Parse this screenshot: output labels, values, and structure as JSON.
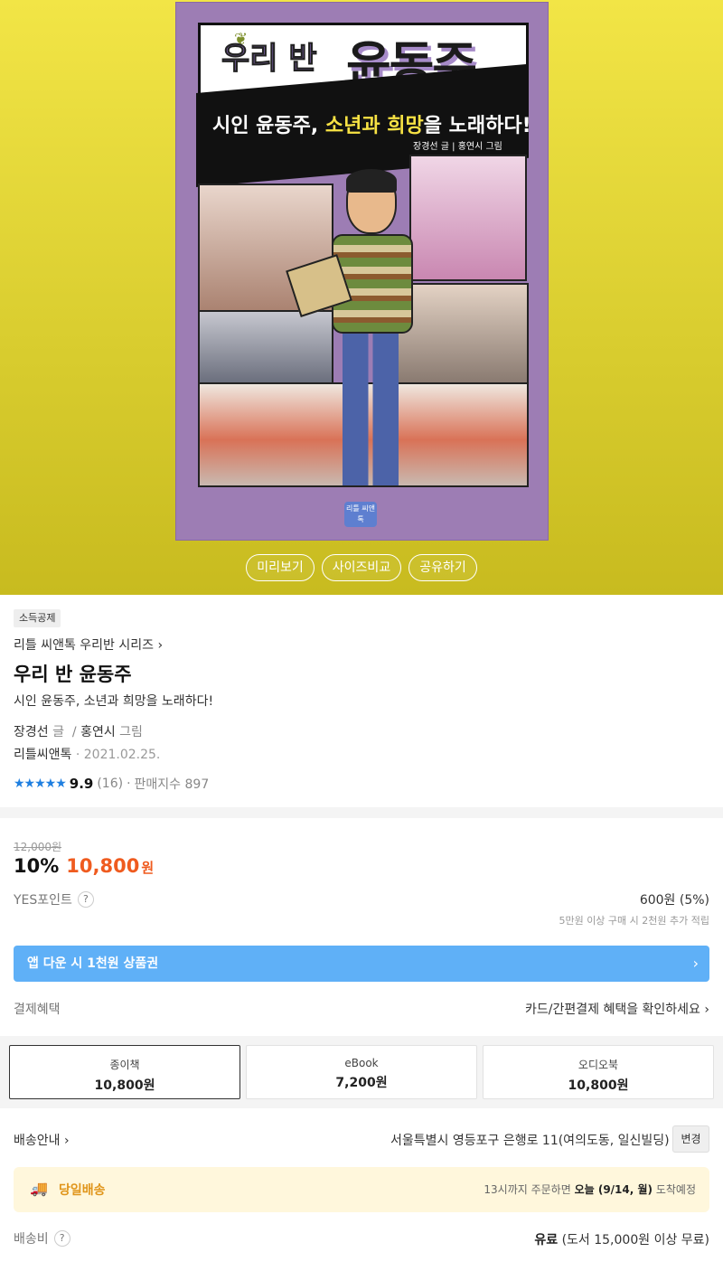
{
  "cover": {
    "title_small": "우리 반",
    "title_big": "윤동주",
    "subtitle_a": "시인 윤동주, ",
    "subtitle_b": "소년과 희망",
    "subtitle_c": "을 노래하다!",
    "authors": "장경선 글 | 홍연시 그림",
    "publisher_mark": "리틀 씨앤톡"
  },
  "hero_buttons": [
    "미리보기",
    "사이즈비교",
    "공유하기"
  ],
  "badge": "소득공제",
  "series": "리틀 씨앤톡 우리반 시리즈",
  "title": "우리 반 윤동주",
  "subtitle": "시인 윤동주, 소년과 희망을 노래하다!",
  "author": {
    "name": "장경선",
    "role": "글",
    "sep": "/",
    "illustrator": "홍연시",
    "illustrator_role": "그림"
  },
  "publisher": {
    "name": "리틀씨앤톡",
    "date": "2021.02.25."
  },
  "rating": {
    "stars": "★★★★★",
    "score": "9.9",
    "count": "(16)",
    "sales": "판매지수 897"
  },
  "price": {
    "original": "12,000원",
    "discount": "10%",
    "sale": "10,800",
    "won": "원"
  },
  "yes_point": {
    "label": "YES포인트",
    "value": "600원 (5%)",
    "note": "5만원 이상 구매 시 2천원 추가 적립"
  },
  "app_banner": "앱 다운 시 1천원 상품권",
  "payment": {
    "label": "결제혜택",
    "link": "카드/간편결제 혜택을 확인하세요"
  },
  "formats": [
    {
      "name": "종이책",
      "price": "10,800원"
    },
    {
      "name": "eBook",
      "price": "7,200원"
    },
    {
      "name": "오디오북",
      "price": "10,800원"
    }
  ],
  "shipping": {
    "label": "배송안내",
    "address": "서울특별시 영등포구 은행로 11(여의도동, 일신빌딩)",
    "change": "변경",
    "sameday_label": "당일배송",
    "sameday_msg_a": "13시까지 주문하면 ",
    "sameday_msg_b": "오늘 (9/14, 월)",
    "sameday_msg_c": " 도착예정",
    "fee_label": "배송비",
    "fee_value": "유료",
    "fee_note": " (도서 15,000원 이상 무료)"
  },
  "colors": {
    "accent": "#ef5b1f",
    "app_banner": "#5fb0f7",
    "stars": "#1f7fe0",
    "hero_bg": "#f2e546"
  }
}
